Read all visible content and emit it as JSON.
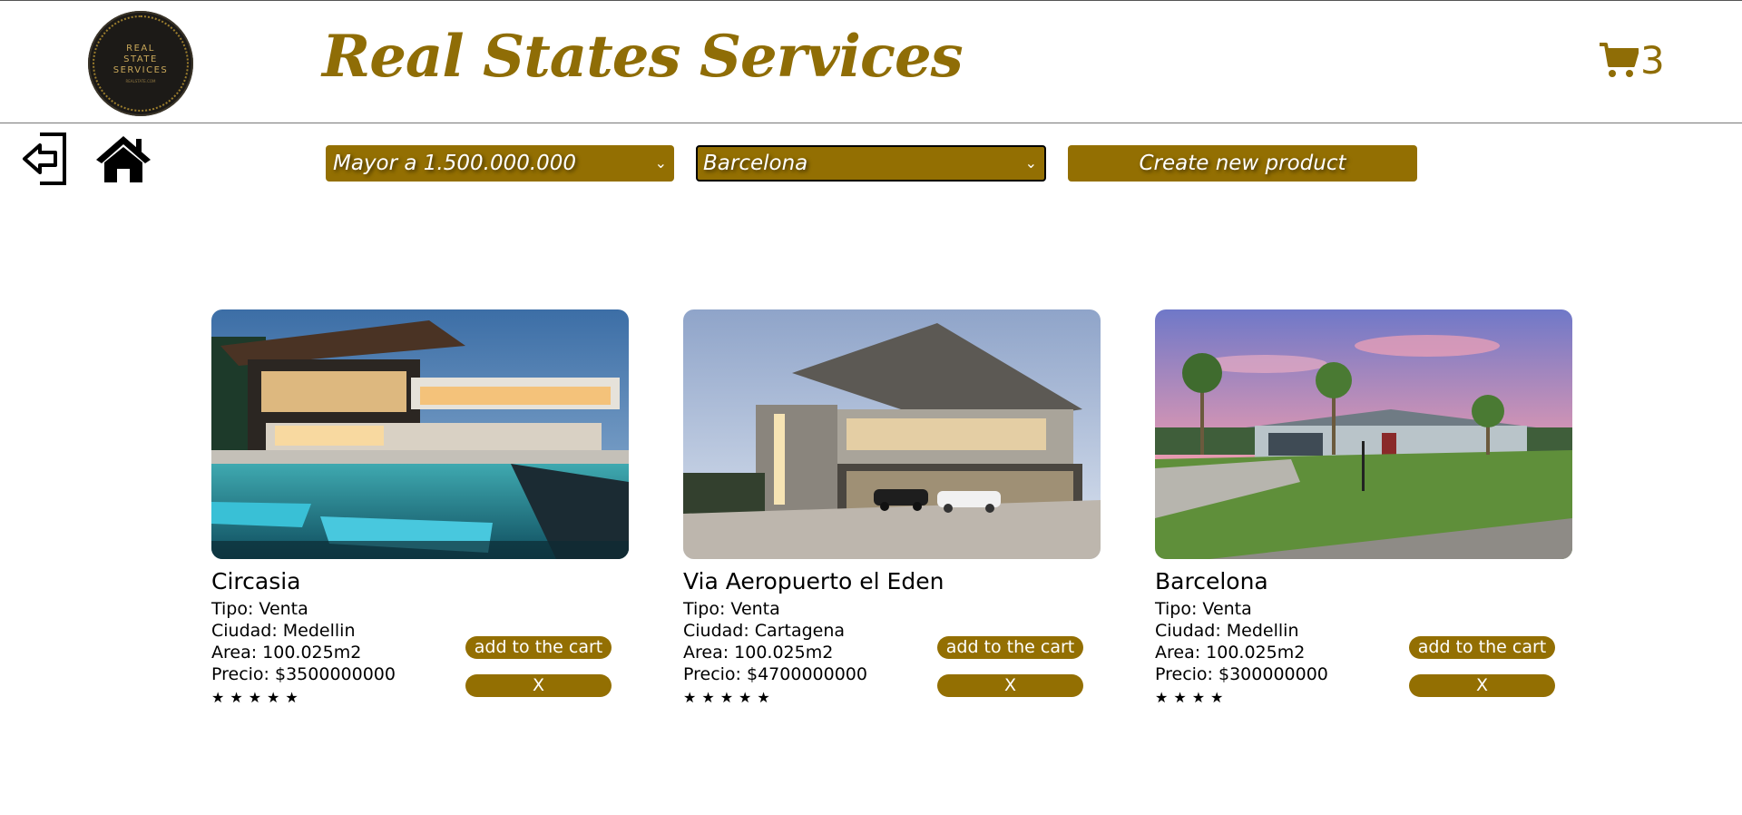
{
  "header": {
    "logo_lines": [
      "REAL",
      "STATE",
      "SERVICES"
    ],
    "logo_sub": "REALSTATE.COM",
    "title": "Real States Services",
    "cart_count": "3"
  },
  "toolbar": {
    "price_filter": {
      "selected": "Mayor a 1.500.000.000"
    },
    "city_filter": {
      "selected": "Barcelona"
    },
    "create_label": "Create new product"
  },
  "colors": {
    "accent": "#936f02",
    "title": "#8f6d06"
  },
  "icons": {
    "logout": "logout-icon",
    "home": "home-icon",
    "cart": "cart-icon"
  },
  "products": [
    {
      "title": "Circasia",
      "tipo": "Tipo: Venta",
      "ciudad": "Ciudad: Medellin",
      "area": "Area: 100.025m2",
      "precio": "Precio: $3500000000",
      "rating": 5,
      "stars": "★★★★★",
      "add_label": "add to the cart",
      "remove_label": "X"
    },
    {
      "title": "Via Aeropuerto el Eden",
      "tipo": "Tipo: Venta",
      "ciudad": "Ciudad: Cartagena",
      "area": "Area: 100.025m2",
      "precio": "Precio: $4700000000",
      "rating": 5,
      "stars": "★★★★★",
      "add_label": "add to the cart",
      "remove_label": "X"
    },
    {
      "title": "Barcelona",
      "tipo": "Tipo: Venta",
      "ciudad": "Ciudad: Medellin",
      "area": "Area: 100.025m2",
      "precio": "Precio: $300000000",
      "rating": 4,
      "stars": "★★★★",
      "add_label": "add to the cart",
      "remove_label": "X"
    }
  ]
}
